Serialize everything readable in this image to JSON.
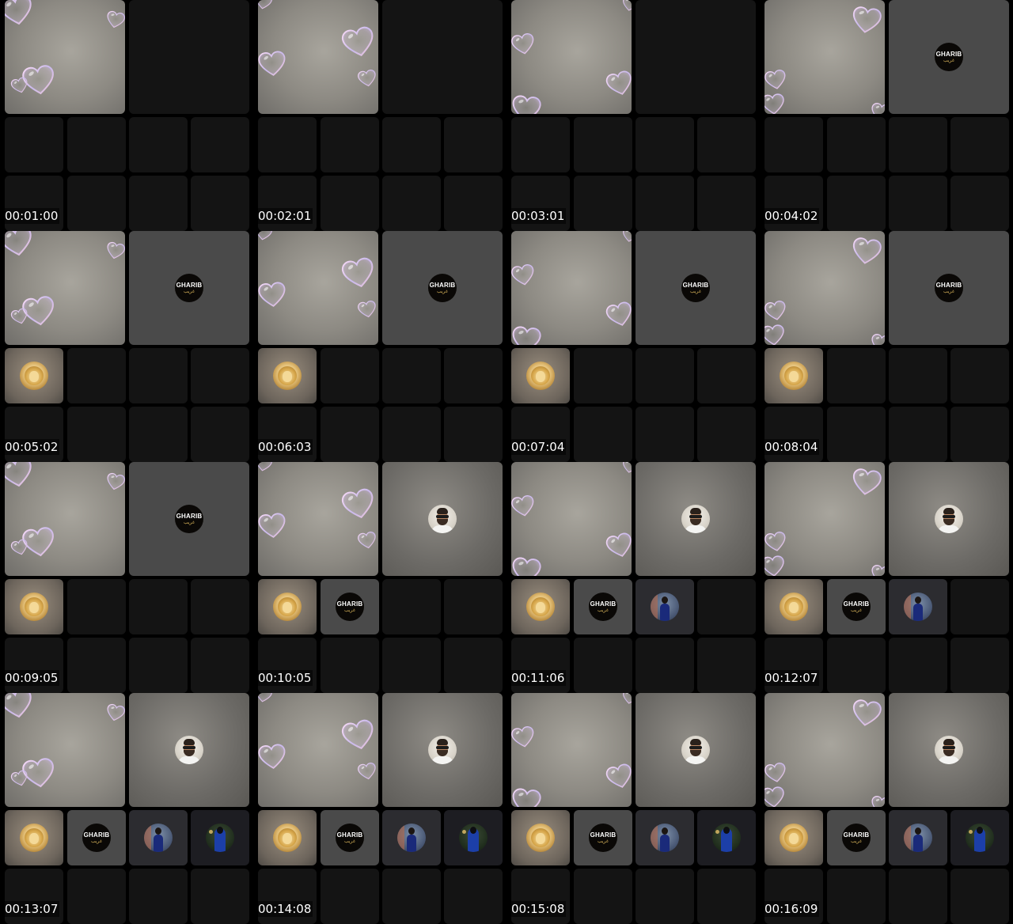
{
  "contact_sheet": {
    "frames": [
      {
        "timestamp": "00:01:00",
        "tiles": [
          "hearts-a",
          "empty",
          "empty",
          "empty",
          "empty",
          "empty",
          "empty",
          "empty",
          "empty",
          "empty"
        ]
      },
      {
        "timestamp": "00:02:01",
        "tiles": [
          "hearts-b",
          "empty",
          "empty",
          "empty",
          "empty",
          "empty",
          "empty",
          "empty",
          "empty",
          "empty"
        ]
      },
      {
        "timestamp": "00:03:01",
        "tiles": [
          "hearts-c",
          "empty",
          "empty",
          "empty",
          "empty",
          "empty",
          "empty",
          "empty",
          "empty",
          "empty"
        ]
      },
      {
        "timestamp": "00:04:02",
        "tiles": [
          "hearts-d",
          "logo-big",
          "empty",
          "empty",
          "empty",
          "empty",
          "empty",
          "empty",
          "empty",
          "empty"
        ]
      },
      {
        "timestamp": "00:05:02",
        "tiles": [
          "hearts-a",
          "logo-big",
          "lion",
          "empty",
          "empty",
          "empty",
          "empty",
          "empty",
          "empty",
          "empty"
        ]
      },
      {
        "timestamp": "00:06:03",
        "tiles": [
          "hearts-b",
          "logo-big",
          "lion",
          "empty",
          "empty",
          "empty",
          "empty",
          "empty",
          "empty",
          "empty"
        ]
      },
      {
        "timestamp": "00:07:04",
        "tiles": [
          "hearts-c",
          "logo-big",
          "lion",
          "empty",
          "empty",
          "empty",
          "empty",
          "empty",
          "empty",
          "empty"
        ]
      },
      {
        "timestamp": "00:08:04",
        "tiles": [
          "hearts-d",
          "logo-big",
          "lion",
          "empty",
          "empty",
          "empty",
          "empty",
          "empty",
          "empty",
          "empty"
        ]
      },
      {
        "timestamp": "00:09:05",
        "tiles": [
          "hearts-a",
          "logo-big",
          "lion",
          "empty",
          "empty",
          "empty",
          "empty",
          "empty",
          "empty",
          "empty"
        ]
      },
      {
        "timestamp": "00:10:05",
        "tiles": [
          "hearts-b",
          "man-big",
          "lion",
          "logo-small",
          "empty",
          "empty",
          "empty",
          "empty",
          "empty",
          "empty"
        ]
      },
      {
        "timestamp": "00:11:06",
        "tiles": [
          "hearts-c",
          "man-big",
          "lion",
          "logo-small",
          "woman",
          "empty",
          "empty",
          "empty",
          "empty",
          "empty"
        ]
      },
      {
        "timestamp": "00:12:07",
        "tiles": [
          "hearts-d",
          "man-big",
          "lion",
          "logo-small",
          "woman",
          "empty",
          "empty",
          "empty",
          "empty",
          "empty"
        ]
      },
      {
        "timestamp": "00:13:07",
        "tiles": [
          "hearts-a",
          "man-big",
          "lion",
          "logo-small",
          "woman",
          "abaya",
          "empty",
          "empty",
          "empty",
          "empty"
        ]
      },
      {
        "timestamp": "00:14:08",
        "tiles": [
          "hearts-b",
          "man-big",
          "lion",
          "logo-small",
          "woman",
          "abaya",
          "empty",
          "empty",
          "empty",
          "empty"
        ]
      },
      {
        "timestamp": "00:15:08",
        "tiles": [
          "hearts-c",
          "man-big",
          "lion",
          "logo-small",
          "woman",
          "abaya",
          "empty",
          "empty",
          "empty",
          "empty"
        ]
      },
      {
        "timestamp": "00:16:09",
        "tiles": [
          "hearts-d",
          "man-big",
          "lion",
          "logo-small",
          "woman",
          "abaya",
          "empty",
          "empty",
          "empty",
          "empty"
        ]
      }
    ]
  },
  "logo": {
    "line1": "GHARIB",
    "line2": "غريب"
  },
  "colors": {
    "background": "#000000",
    "empty_tile": "#141414",
    "timestamp_text": "#ffffff",
    "heart_tint": "#e6c8ee"
  },
  "icons": {
    "heart": "heart-bubble-icon",
    "lion": "lion-avatar-icon",
    "logo": "gharib-logo-icon",
    "man": "man-avatar-icon",
    "woman": "woman-avatar-icon",
    "abaya": "abaya-avatar-icon"
  }
}
